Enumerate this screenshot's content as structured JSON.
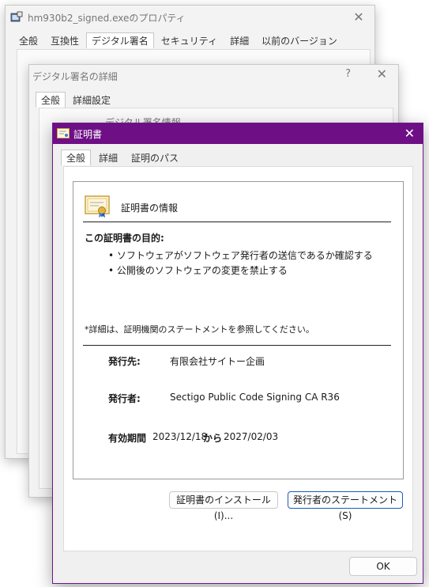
{
  "props_window": {
    "title": "hm930b2_signed.exeのプロパティ",
    "close_glyph": "✕",
    "tabs": [
      "全般",
      "互換性",
      "デジタル署名",
      "セキュリティ",
      "詳細",
      "以前のバージョン"
    ],
    "active_tab": "デジタル署名"
  },
  "details_window": {
    "title": "デジタル署名の詳細",
    "help_glyph": "?",
    "close_glyph": "✕",
    "tabs": [
      "全般",
      "詳細設定"
    ],
    "peek_text": "デジタル署名情報"
  },
  "cert_window": {
    "title": "証明書",
    "close_glyph": "✕",
    "tabs": [
      "全般",
      "詳細",
      "証明のパス"
    ],
    "heading": "証明書の情報",
    "purpose_heading": "この証明書の目的:",
    "purposes": [
      "• ソフトウェアがソフトウェア発行者の送信であるか確認する",
      "• 公開後のソフトウェアの変更を禁止する"
    ],
    "note": "*詳細は、証明機関のステートメントを参照してください。",
    "issued_to_label": "発行先:",
    "issued_to": "有限会社サイトー企画",
    "issued_by_label": "発行者:",
    "issued_by": "Sectigo Public Code Signing CA R36",
    "validity_label": "有効期間",
    "valid_from": "2023/12/18",
    "valid_to_word": "から",
    "valid_to": "2027/02/03",
    "install_button": "証明書のインストール(I)...",
    "statement_button": "発行者のステートメント(S)",
    "ok_button": "OK"
  },
  "colors": {
    "accent_titlebar": "#6e0f86",
    "focus_button_border": "#1a5fb4"
  }
}
